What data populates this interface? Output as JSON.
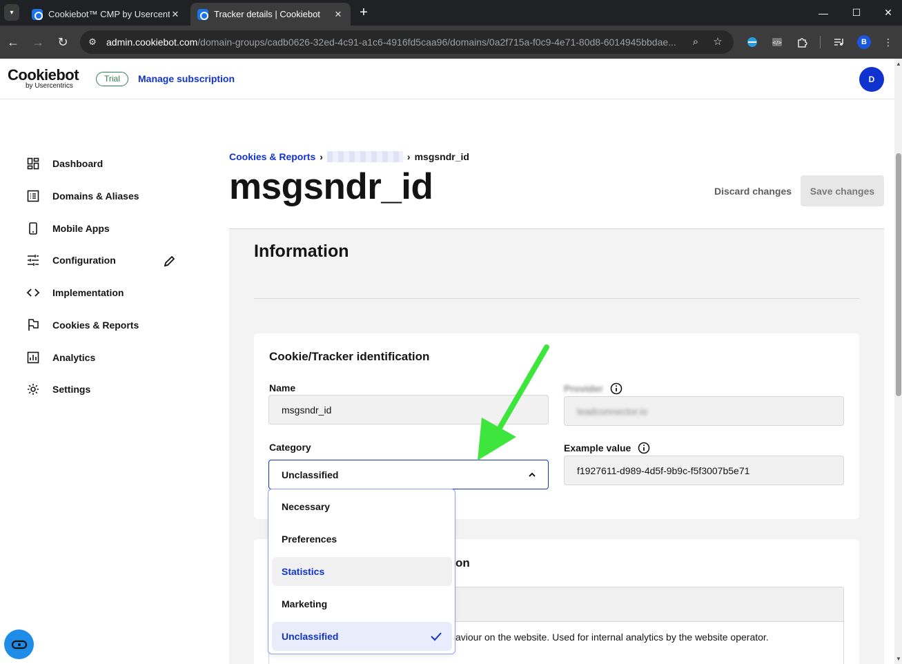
{
  "browser": {
    "tabs": [
      {
        "title": "Cookiebot™ CMP by Usercentri",
        "active": false
      },
      {
        "title": "Tracker details | Cookiebot",
        "active": true
      }
    ],
    "url_host": "admin.cookiebot.com",
    "url_path": "/domain-groups/cadb0626-32ed-4c91-a1c6-4916fd5caa96/domains/0a2f715a-f0c9-4e71-80d8-6014945bbdae...",
    "profile_initial": "B"
  },
  "header": {
    "logo_main": "Cookiebot",
    "logo_sub": "by Usercentrics",
    "trial_badge": "Trial",
    "manage_subscription": "Manage subscription",
    "user_initial": "D"
  },
  "sidebar": {
    "items": [
      {
        "label": "Dashboard",
        "icon": "dashboard-icon"
      },
      {
        "label": "Domains & Aliases",
        "icon": "list-icon"
      },
      {
        "label": "Mobile Apps",
        "icon": "mobile-icon"
      },
      {
        "label": "Configuration",
        "icon": "sliders-icon"
      },
      {
        "label": "Implementation",
        "icon": "code-icon"
      },
      {
        "label": "Cookies & Reports",
        "icon": "flag-icon"
      },
      {
        "label": "Analytics",
        "icon": "chart-icon"
      },
      {
        "label": "Settings",
        "icon": "gear-icon"
      }
    ]
  },
  "main": {
    "breadcrumb": {
      "root": "Cookies & Reports",
      "current": "msgsndr_id"
    },
    "title": "msgsndr_id",
    "discard_label": "Discard changes",
    "save_label": "Save changes",
    "section_title": "Information",
    "card_title": "Cookie/Tracker identification",
    "name_label": "Name",
    "name_value": "msgsndr_id",
    "provider_label": "Provider",
    "provider_value": "leadconnector.io",
    "category_label": "Category",
    "category_value": "Unclassified",
    "example_label": "Example value",
    "example_value": "f1927611-d989-4d5f-9b9c-f5f3007b5e71",
    "card2_title_fragment": "on",
    "description_fragment": "aviour on the website. Used for internal analytics by the website operator."
  },
  "dropdown": {
    "options": [
      "Necessary",
      "Preferences",
      "Statistics",
      "Marketing",
      "Unclassified"
    ],
    "hovered": "Statistics",
    "selected": "Unclassified"
  },
  "colors": {
    "accent": "#1032cf",
    "annotation_arrow": "#3de53d",
    "fab": "#1f8de8"
  }
}
